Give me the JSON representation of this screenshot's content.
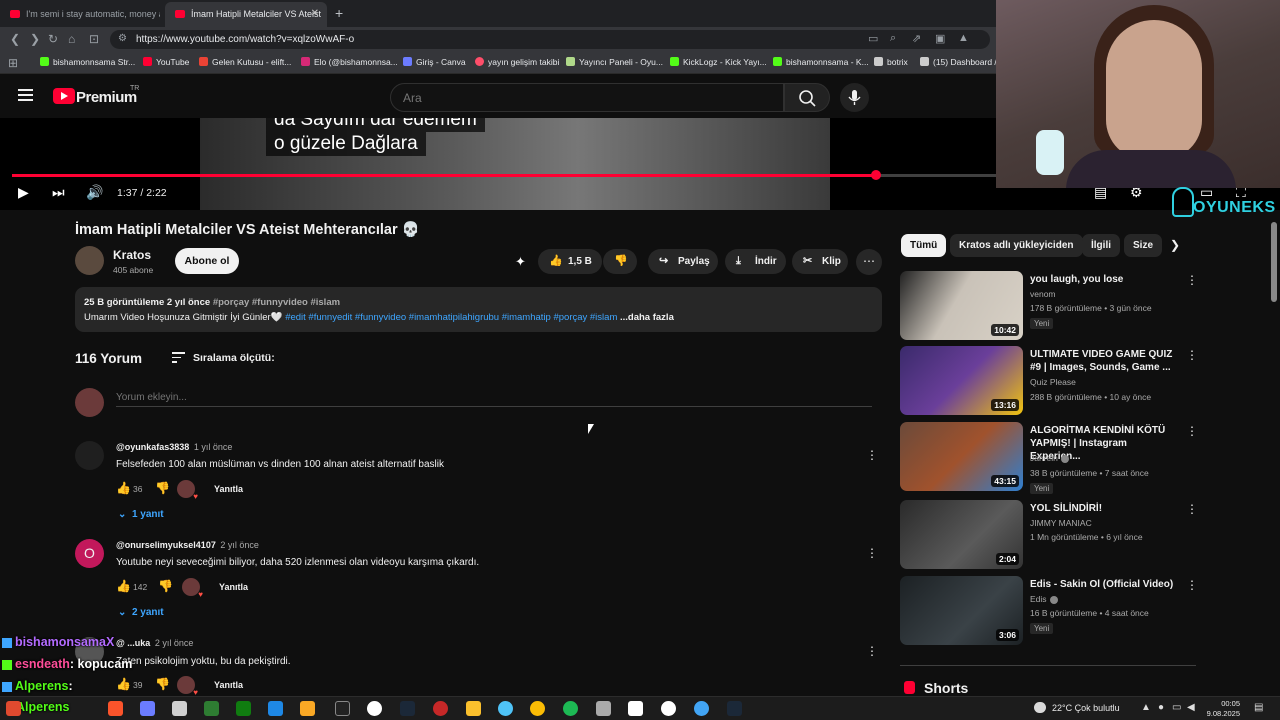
{
  "browser": {
    "tabs": [
      {
        "title": "I'm semi i stay automatic, money add..."
      },
      {
        "title": "İmam Hatipli Metalciler VS Ateist"
      }
    ],
    "new_tab": "+",
    "url": "https://www.youtube.com/watch?v=xqlzoWwAF-o",
    "bookmarks": [
      {
        "label": "bishamonnsama Str...",
        "color": "#53fc18"
      },
      {
        "label": "YouTube",
        "color": "#ff0033"
      },
      {
        "label": "Gelen Kutusu - elift...",
        "color": "#ea4335"
      },
      {
        "label": "Elo (@bishamonnsa...",
        "color": "#d62976"
      },
      {
        "label": "Giriş - Canva",
        "color": "#6c7cff"
      },
      {
        "label": "yayın gelişim takibi",
        "color": "#ff4e6a"
      },
      {
        "label": "Yayıncı Paneli - Oyu...",
        "color": "#b0d98a"
      },
      {
        "label": "KickLogz - Kick Yayı...",
        "color": "#53fc18"
      },
      {
        "label": "bishamonnsama - K...",
        "color": "#53fc18"
      },
      {
        "label": "botrix",
        "color": "#cccccc"
      },
      {
        "label": "(15) Dashboard /",
        "color": "#cccccc"
      }
    ]
  },
  "yt_header": {
    "brand": "Premium",
    "country": "TR",
    "search_placeholder": "Ara"
  },
  "player": {
    "subtitle_lines": [
      "da Saydım dar edemem",
      "o güzele Dağlara"
    ],
    "time": "1:37 / 2:22",
    "progress": 0.873
  },
  "video": {
    "title": "İmam Hatipli Metalciler VS Ateist Mehterancılar 💀",
    "channel": "Kratos",
    "subscribers": "405 abone",
    "subscribe_label": "Abone ol",
    "likes": "1,5 B",
    "share_label": "Paylaş",
    "download_label": "İndir",
    "clip_label": "Klip",
    "views_date": "25 B görüntüleme  2 yıl önce",
    "meta_tags": "#porçay #funnyvideo #islam",
    "description": "Umarım Video Hoşunuza Gitmiştir İyi Günler🤍",
    "desc_tags": "#edit #funnyedit #funnyvideo #imamhatipilahigrubu #imamhatip #porçay #islam",
    "more_label": "...daha fazla"
  },
  "comments": {
    "count_label": "116 Yorum",
    "sort_label": "Sıralama ölçütü:",
    "add_placeholder": "Yorum ekleyin...",
    "reply_label": "Yanıtla",
    "items": [
      {
        "user": "@oyunkafas3838",
        "ago": "1 yıl önce",
        "text": "Felsefeden 100 alan müslüman vs dinden 100 alnan ateist alternatif baslik",
        "likes": "36",
        "replies": "1 yanıt",
        "avatar_color": "#1f1f1f"
      },
      {
        "user": "@onurselimyuksel4107",
        "ago": "2 yıl önce",
        "text": "Youtube neyi seveceğimi biliyor, daha 520 izlenmesi olan videoyu karşıma çıkardı.",
        "likes": "142",
        "replies": "2 yanıt",
        "avatar_color": "#c2185b",
        "avatar_letter": "O"
      },
      {
        "user": "@ ...uka",
        "ago": "2 yıl önce",
        "text": "Zaten psikolojim yoktu, bu da pekiştirdi.",
        "likes": "39",
        "avatar_color": "#555555"
      }
    ]
  },
  "chips": [
    "Tümü",
    "Kratos adlı yükleyiciden",
    "İlgili",
    "Size"
  ],
  "recommendations": [
    {
      "title": "you laugh, you lose",
      "channel": "venom",
      "meta": "178 B görüntüleme • 3 gün önce",
      "badge": "Yeni",
      "duration": "10:42",
      "thumb": "#c9c2b8",
      "verified": false
    },
    {
      "title": "ULTIMATE VIDEO GAME QUIZ #9 | Images, Sounds, Game ...",
      "channel": "Quiz Please",
      "meta": "288 B görüntüleme • 10 ay önce",
      "badge": "",
      "duration": "13:16",
      "thumb": "#6a3f9a",
      "verified": false
    },
    {
      "title": "ALGORİTMA KENDİNİ KÖTÜ YAPMIŞ! | Instagram Experien...",
      "channel": "Jahrein",
      "meta": "38 B görüntüleme • 7 saat önce",
      "badge": "Yeni",
      "duration": "43:15",
      "thumb": "#a0522d",
      "verified": true
    },
    {
      "title": "YOL SİLİNDİRİ!",
      "channel": "JIMMY MANIAC",
      "meta": "1 Mn görüntüleme • 6 yıl önce",
      "badge": "",
      "duration": "2:04",
      "thumb": "#444444",
      "verified": false
    },
    {
      "title": "Edis - Sakin Ol (Official Video)",
      "channel": "Edis",
      "meta": "16 B görüntüleme • 4 saat önce",
      "badge": "Yeni",
      "duration": "3:06",
      "thumb": "#2a2f33",
      "verified": true
    }
  ],
  "shorts_label": "Shorts",
  "overlay": {
    "brand": "OYUNEKS",
    "chat": [
      {
        "user": "bishamonsamaX",
        "user_color": "#b36bff",
        "message": "",
        "icon_color": "#3ea6ff"
      },
      {
        "user": "esndeath",
        "user_color": "#ff4e9a",
        "message": ": kopucam",
        "icon_color": "#53fc18"
      },
      {
        "user": "Alperens",
        "user_color": "#53fc18",
        "message": ":",
        "icon_color": "#3ea6ff"
      },
      {
        "user": "Alperens",
        "user_color": "#53fc18",
        "message": "",
        "icon_color": "#3ea6ff"
      }
    ]
  },
  "taskbar": {
    "weather": "22°C  Çok bulutlu",
    "time": "00:05",
    "date": "9.08.2025",
    "icons": [
      "#e04a2f",
      "#ffffff",
      "#6b7cff",
      "#d0d0d0",
      "#2e7d32",
      "#1e88e5",
      "#f9a825",
      "#222222",
      "#ffffff",
      "#1b2838",
      "#c62828",
      "#fbc02d",
      "#4fc3f7",
      "#fbbc05",
      "#1db954",
      "#aaaaaa",
      "#ffffff",
      "#ffffff",
      "#42a5f5",
      "#1b2838"
    ]
  }
}
